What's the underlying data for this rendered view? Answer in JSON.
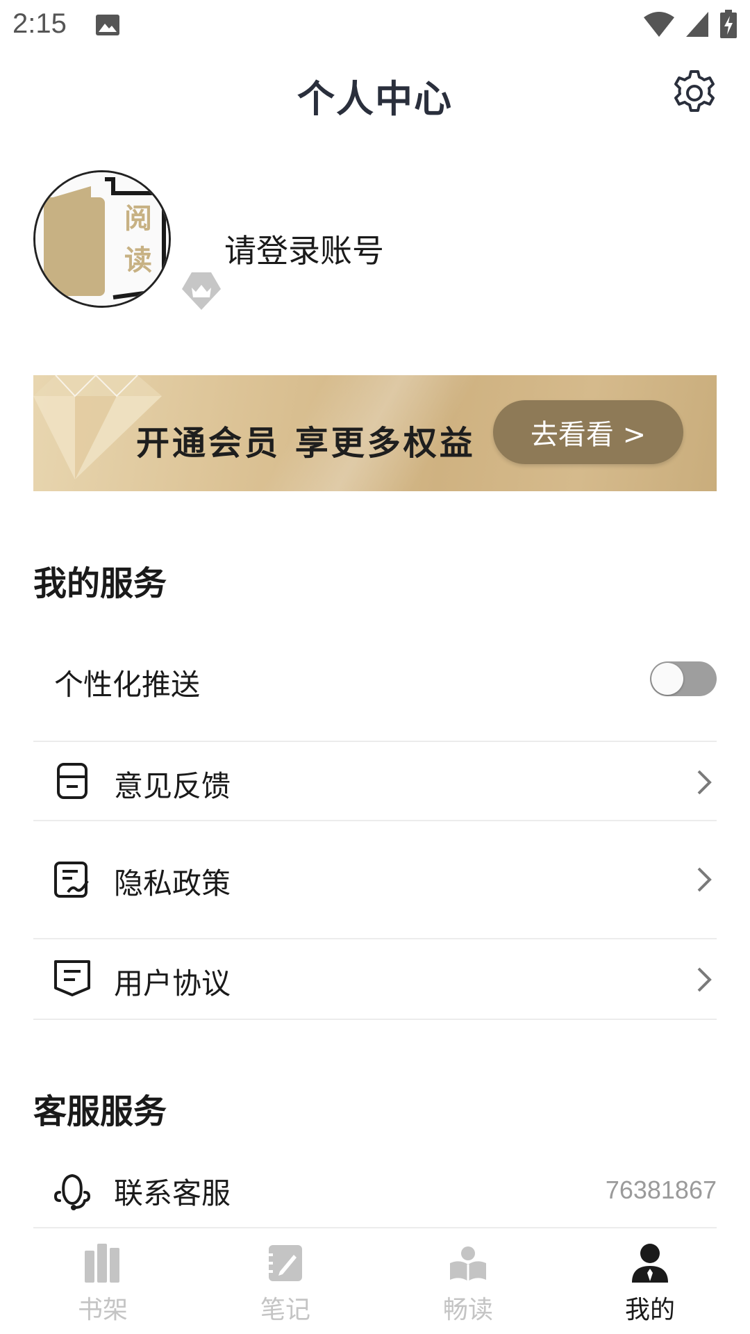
{
  "status_bar": {
    "time": "2:15",
    "icons": [
      "image-icon",
      "wifi-icon",
      "signal-icon",
      "battery-charging-icon"
    ]
  },
  "header": {
    "title": "个人中心",
    "settings_icon": "gear-icon"
  },
  "profile": {
    "avatar_text_1": "阅",
    "avatar_text_2": "读",
    "login_prompt": "请登录账号",
    "vip_badge_icon": "crown-icon"
  },
  "vip_banner": {
    "text": "开通会员  享更多权益",
    "button_label": "去看看 >",
    "colors": {
      "button": "#8e7a57",
      "background": "#dcc396"
    }
  },
  "my_services": {
    "title": "我的服务",
    "personalized_push": {
      "label": "个性化推送",
      "enabled": false
    },
    "items": [
      {
        "label": "意见反馈",
        "icon": "feedback-icon"
      },
      {
        "label": "隐私政策",
        "icon": "privacy-policy-icon"
      },
      {
        "label": "用户协议",
        "icon": "user-agreement-icon"
      }
    ]
  },
  "customer_services": {
    "title": "客服服务",
    "contact": {
      "label": "联系客服",
      "value": "76381867",
      "icon": "headset-icon"
    }
  },
  "bottom_nav": {
    "items": [
      {
        "label": "书架",
        "icon": "bookshelf-icon",
        "active": false
      },
      {
        "label": "笔记",
        "icon": "notes-icon",
        "active": false
      },
      {
        "label": "畅读",
        "icon": "reading-icon",
        "active": false
      },
      {
        "label": "我的",
        "icon": "profile-icon",
        "active": true
      }
    ],
    "colors": {
      "active": "#1a1a1a",
      "inactive": "#c4c4c4"
    }
  }
}
